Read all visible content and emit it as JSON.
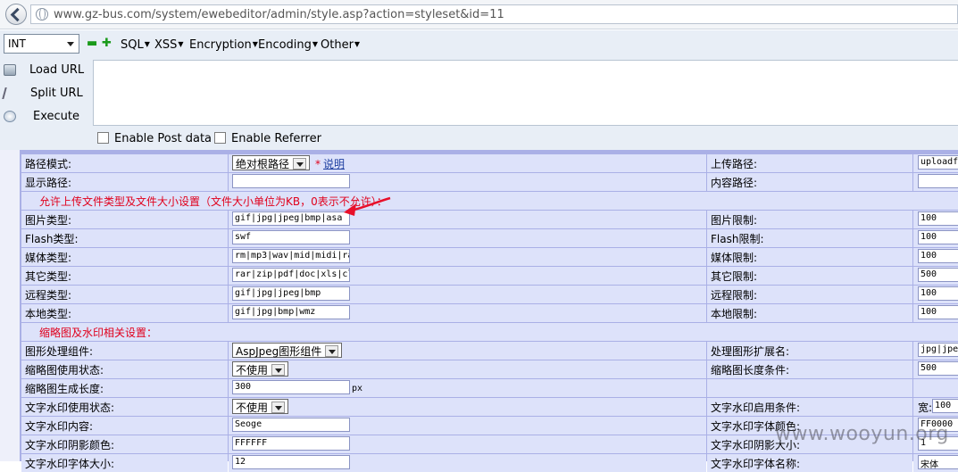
{
  "browser": {
    "url": "www.gz-bus.com/system/ewebeditor/admin/style.asp?action=styleset&id=11"
  },
  "hackbar": {
    "type_select": "INT",
    "menus": [
      "SQL",
      "XSS",
      "Encryption",
      "Encoding",
      "Other"
    ],
    "buttons": {
      "load_url": "Load URL",
      "split_url": "Split URL",
      "execute": "Execute"
    },
    "url_text": "",
    "enable_post": "Enable Post data",
    "enable_referrer": "Enable Referrer"
  },
  "form": {
    "rows": [
      {
        "label": "路径模式:",
        "select": "绝对根路径",
        "star": "*",
        "link": "说明",
        "right_label": "上传路径:",
        "right_value": "uploadf"
      },
      {
        "label": "显示路径:",
        "value": "",
        "right_label": "内容路径:",
        "right_value": ""
      }
    ],
    "section1": "允许上传文件类型及文件大小设置（文件大小单位为KB，0表示不允许）：",
    "file_rows": [
      {
        "label": "图片类型:",
        "value": "gif|jpg|jpeg|bmp|asa",
        "right_label": "图片限制:",
        "right_value": "100"
      },
      {
        "label": "Flash类型:",
        "value": "swf",
        "right_label": "Flash限制:",
        "right_value": "100"
      },
      {
        "label": "媒体类型:",
        "value": "rm|mp3|wav|mid|midi|ra",
        "right_label": "媒体限制:",
        "right_value": "100"
      },
      {
        "label": "其它类型:",
        "value": "rar|zip|pdf|doc|xls|cl",
        "right_label": "其它限制:",
        "right_value": "500"
      },
      {
        "label": "远程类型:",
        "value": "gif|jpg|jpeg|bmp",
        "right_label": "远程限制:",
        "right_value": "100"
      },
      {
        "label": "本地类型:",
        "value": "gif|jpg|bmp|wmz",
        "right_label": "本地限制:",
        "right_value": "100"
      }
    ],
    "section2": "缩略图及水印相关设置：",
    "thumb_rows": [
      {
        "label": "图形处理组件:",
        "select": "AspJpeg图形组件",
        "right_label": "处理图形扩展名:",
        "right_value": "jpg|jpe"
      },
      {
        "label": "缩略图使用状态:",
        "select": "不使用",
        "right_label": "缩略图长度条件:",
        "right_value": "500"
      },
      {
        "label": "缩略图生成长度:",
        "value": "300",
        "unit": "px",
        "right_label": "",
        "right_value": ""
      },
      {
        "label": "文字水印使用状态:",
        "select": "不使用",
        "right_label": "文字水印启用条件:",
        "right_prefix": "宽:",
        "right_value": "100"
      },
      {
        "label": "文字水印内容:",
        "value": "Seoge",
        "right_label": "文字水印字体颜色:",
        "right_value": "FF0000"
      },
      {
        "label": "文字水印阴影颜色:",
        "value": "FFFFFF",
        "right_label": "文字水印阴影大小:",
        "right_value": "1"
      },
      {
        "label": "文字水印字体大小:",
        "value": "12",
        "right_label": "文字水印字体名称:",
        "right_value": "宋体"
      }
    ]
  },
  "watermark": "www.wooyun.org",
  "colors": {
    "section_text": "#e0001c",
    "cell_bg": "#dde2fa",
    "grid": "#aab0e6"
  }
}
